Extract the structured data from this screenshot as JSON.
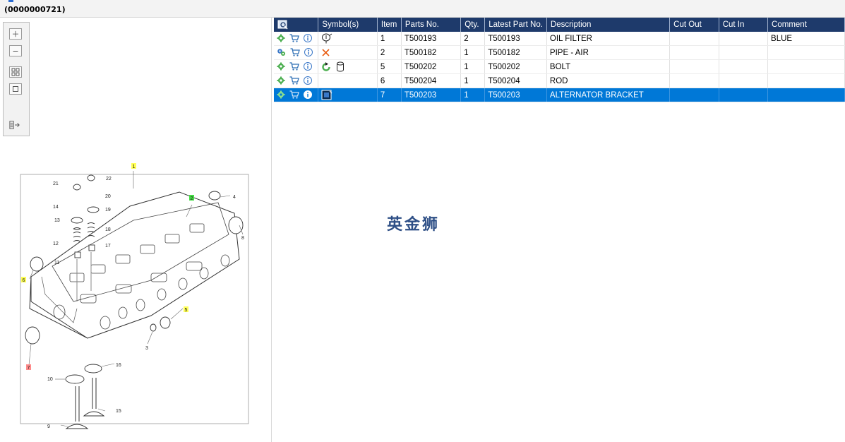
{
  "header": {
    "title": "(0000000721)"
  },
  "diagram": {
    "callouts": [
      "1",
      "2",
      "3",
      "4",
      "5",
      "6",
      "7",
      "8",
      "9",
      "10",
      "11",
      "12",
      "13",
      "14",
      "15",
      "16",
      "17",
      "18",
      "19",
      "20",
      "21",
      "22"
    ]
  },
  "table": {
    "columns": [
      "Symbol(s)",
      "Item",
      "Parts No.",
      "Qty.",
      "Latest Part No.",
      "Description",
      "Cut Out",
      "Cut In",
      "Comment"
    ],
    "rows": [
      {
        "item": "1",
        "parts_no": "T500193",
        "qty": "2",
        "latest": "T500193",
        "description": "OIL FILTER",
        "cut_out": "",
        "cut_in": "",
        "comment": "BLUE",
        "row_icons": [
          "gear-icon",
          "cart-icon",
          "info-icon"
        ],
        "symbols": [
          "balloon-icon"
        ]
      },
      {
        "item": "2",
        "parts_no": "T500182",
        "qty": "1",
        "latest": "T500182",
        "description": "PIPE - AIR",
        "cut_out": "",
        "cut_in": "",
        "comment": "",
        "row_icons": [
          "gears-icon",
          "cart-icon",
          "info-icon"
        ],
        "symbols": [
          "cross-icon"
        ]
      },
      {
        "item": "5",
        "parts_no": "T500202",
        "qty": "1",
        "latest": "T500202",
        "description": "BOLT",
        "cut_out": "",
        "cut_in": "",
        "comment": "",
        "row_icons": [
          "gear-icon",
          "cart-icon",
          "info-icon"
        ],
        "symbols": [
          "recycle-icon",
          "cylinder-icon"
        ]
      },
      {
        "item": "6",
        "parts_no": "T500204",
        "qty": "1",
        "latest": "T500204",
        "description": "ROD",
        "cut_out": "",
        "cut_in": "",
        "comment": "",
        "row_icons": [
          "gear-icon",
          "cart-icon",
          "info-icon"
        ],
        "symbols": []
      },
      {
        "item": "7",
        "parts_no": "T500203",
        "qty": "1",
        "latest": "T500203",
        "description": "ALTERNATOR BRACKET",
        "cut_out": "",
        "cut_in": "",
        "comment": "",
        "row_icons": [
          "gear-icon",
          "cart-icon",
          "info-icon"
        ],
        "symbols": [
          "book-icon"
        ],
        "selected": true
      }
    ]
  },
  "watermark": "英金狮",
  "colors": {
    "header_bg": "#1e3a6b",
    "selected_row": "#0078d7",
    "gear": "#4caf50",
    "cart": "#2f6fb5",
    "info": "#3a78c8",
    "cross": "#e85d12"
  }
}
